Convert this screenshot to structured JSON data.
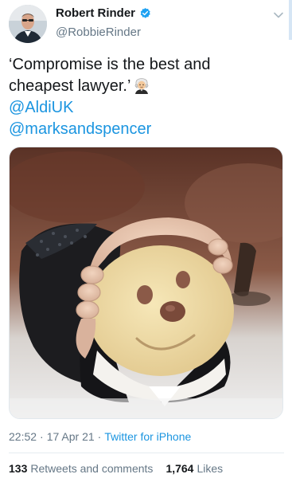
{
  "author": {
    "name": "Robert Rinder",
    "handle": "@RobbieRinder",
    "verified": true
  },
  "tweet": {
    "text_line1": "‘Compromise is the best and",
    "text_line2": "cheapest lawyer.’",
    "emoji": "judge-emoji",
    "mention1": "@AldiUK",
    "mention2": "@marksandspencer"
  },
  "meta": {
    "time": "22:52",
    "sep1": "·",
    "date": "17 Apr 21",
    "sep2": "·",
    "source": "Twitter for iPhone"
  },
  "stats": {
    "retweets_count": "133",
    "retweets_label": "Retweets and comments",
    "likes_count": "1,764",
    "likes_label": "Likes"
  },
  "colors": {
    "link": "#1b95e0",
    "secondary": "#657786",
    "verified": "#1da1f2"
  }
}
